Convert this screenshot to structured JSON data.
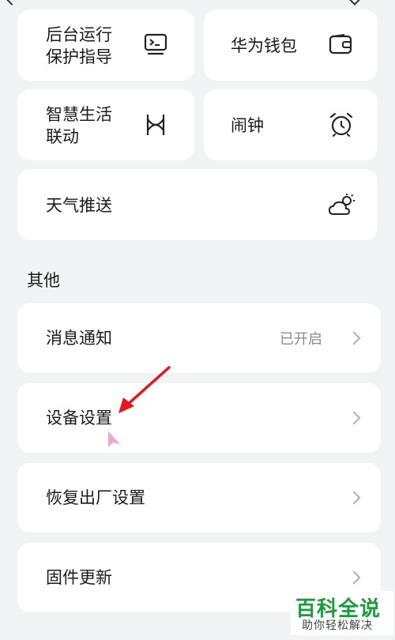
{
  "grid": {
    "items": [
      {
        "label_line1": "后台运行",
        "label_line2": "保护指导",
        "icon": "terminal-icon"
      },
      {
        "label": "华为钱包",
        "icon": "wallet-icon"
      },
      {
        "label_line1": "智慧生活",
        "label_line2": "联动",
        "icon": "smart-link-icon"
      },
      {
        "label": "闹钟",
        "icon": "alarm-clock-icon"
      }
    ],
    "weather": {
      "label": "天气推送",
      "icon": "weather-cloud-sun-icon"
    }
  },
  "section": {
    "title": "其他"
  },
  "list": {
    "items": [
      {
        "label": "消息通知",
        "status": "已开启"
      },
      {
        "label": "设备设置"
      },
      {
        "label": "恢复出厂设置"
      },
      {
        "label": "固件更新"
      }
    ]
  },
  "watermark": {
    "main": "百科全说",
    "sub": "助你轻松解决"
  },
  "colors": {
    "background": "#f1f3f5",
    "card": "#ffffff",
    "annotation": "#e8141e",
    "watermark_green": "#1d9a3a"
  }
}
